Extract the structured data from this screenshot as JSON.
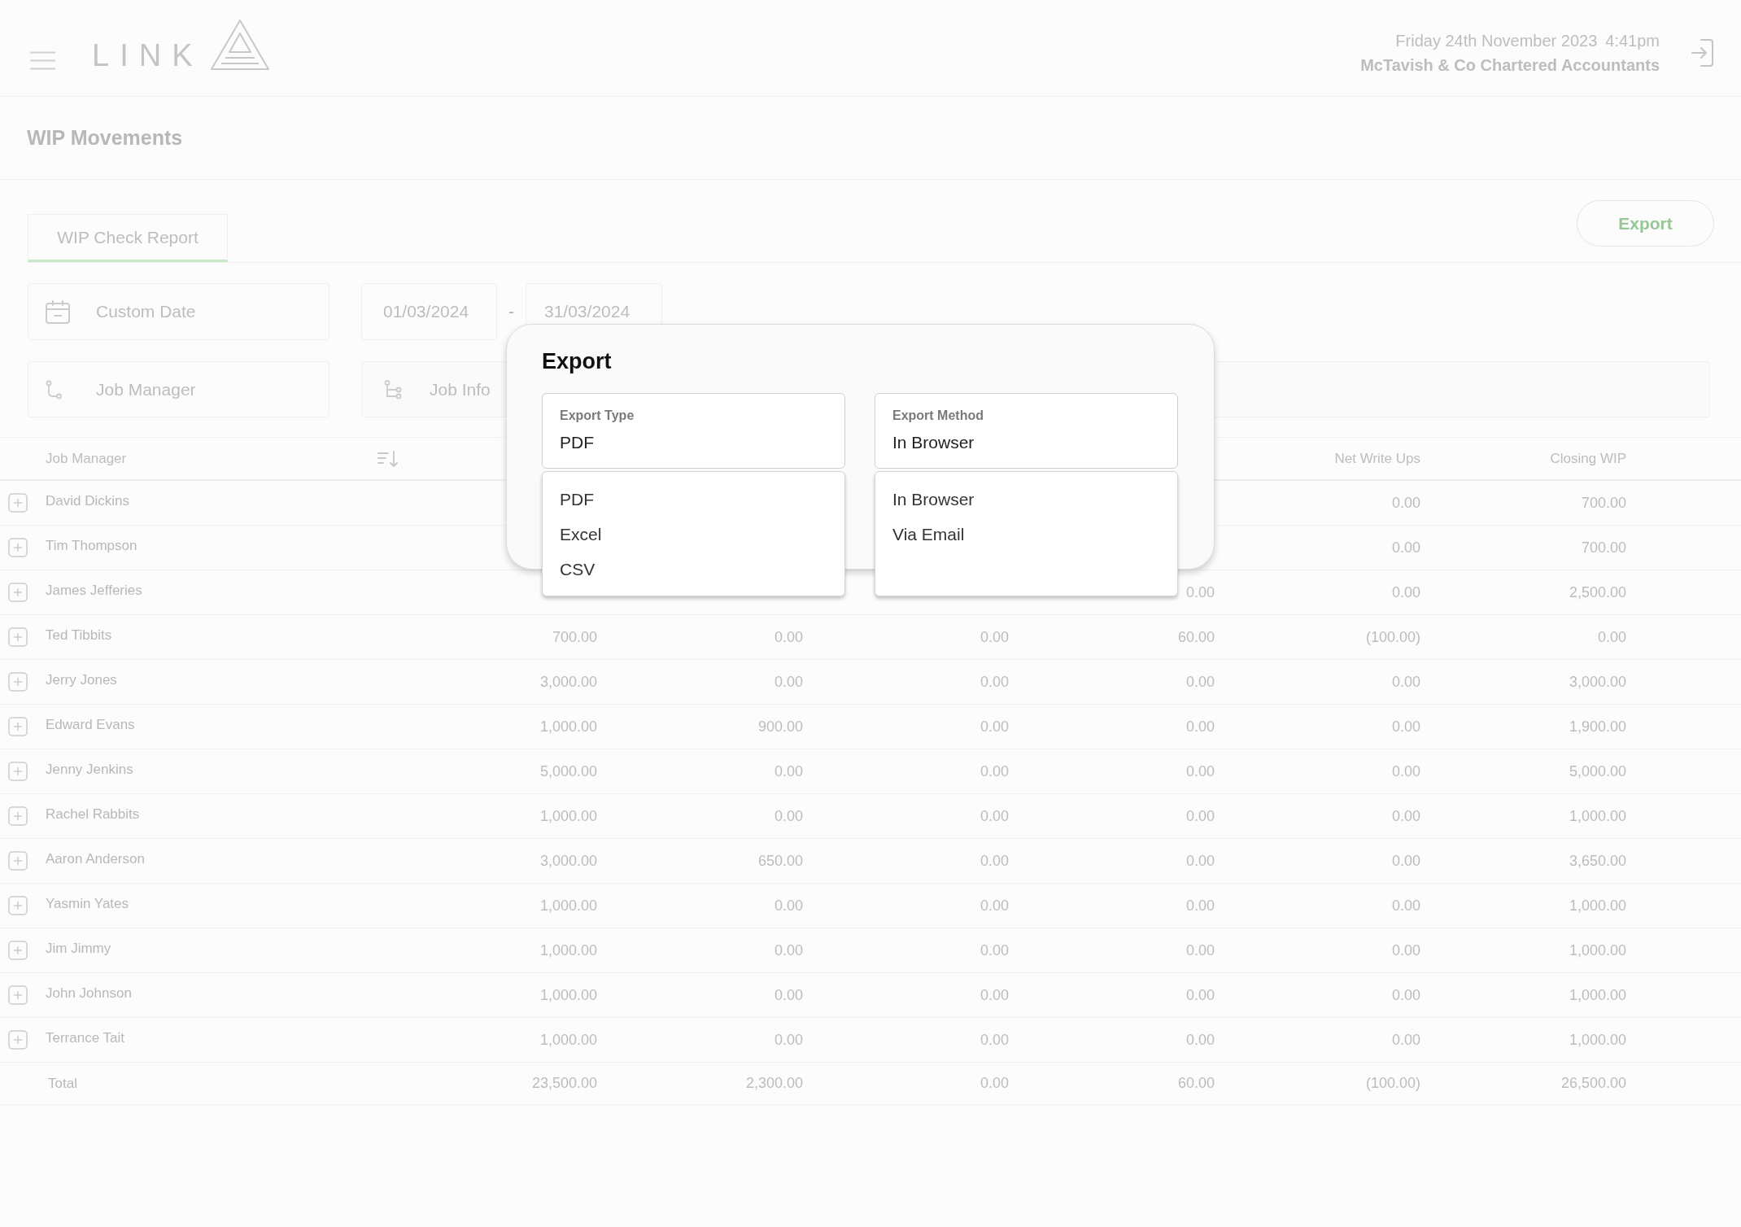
{
  "header": {
    "logo_text": "LINK",
    "date": "Friday 24th November 2023",
    "time": "4:41pm",
    "company": "McTavish & Co Chartered Accountants"
  },
  "page_title": "WIP Movements",
  "tabs": [
    {
      "label": "WIP Check Report",
      "selected": true
    }
  ],
  "export_button": {
    "label": "Export"
  },
  "filters": {
    "date_range": {
      "label": "Custom Date"
    },
    "date_from": {
      "value": "01/03/2024"
    },
    "date_separator": "-",
    "date_to": {
      "value": "31/03/2024"
    },
    "job_manager": {
      "label": "Job Manager"
    },
    "job_info": {
      "label": "Job Info"
    }
  },
  "table": {
    "header": {
      "job_manager": "Job Manager",
      "net_write_ups": "Net Write Ups",
      "closing_wip": "Closing WIP"
    },
    "rows": [
      {
        "job_manager": "David Dickins",
        "expanded": false,
        "net_write_ups": "0.00",
        "closing_wip": "700.00"
      },
      {
        "job_manager": "Tim Thompson",
        "expanded": false,
        "net_write_ups": "0.00",
        "closing_wip": "700.00"
      },
      {
        "job_manager": "James Jefferies",
        "expanded": false,
        "column_5": "0.00",
        "net_write_ups": "0.00",
        "closing_wip": "2,500.00"
      },
      {
        "job_manager": "Ted Tibbits",
        "expanded": false,
        "column_2": "700.00",
        "column_3": "0.00",
        "column_4": "0.00",
        "column_5": "60.00",
        "net_write_ups": "(100.00)",
        "closing_wip": "0.00"
      },
      {
        "job_manager": "Jerry Jones",
        "expanded": false,
        "column_2": "3,000.00",
        "column_3": "0.00",
        "column_4": "0.00",
        "column_5": "0.00",
        "net_write_ups": "0.00",
        "closing_wip": "3,000.00"
      },
      {
        "job_manager": "Edward Evans",
        "expanded": false,
        "column_2": "1,000.00",
        "column_3": "900.00",
        "column_4": "0.00",
        "column_5": "0.00",
        "net_write_ups": "0.00",
        "closing_wip": "1,900.00"
      },
      {
        "job_manager": "Jenny Jenkins",
        "expanded": false,
        "column_2": "5,000.00",
        "column_3": "0.00",
        "column_4": "0.00",
        "column_5": "0.00",
        "net_write_ups": "0.00",
        "closing_wip": "5,000.00"
      },
      {
        "job_manager": "Rachel Rabbits",
        "expanded": false,
        "column_2": "1,000.00",
        "column_3": "0.00",
        "column_4": "0.00",
        "column_5": "0.00",
        "net_write_ups": "0.00",
        "closing_wip": "1,000.00"
      },
      {
        "job_manager": "Aaron Anderson",
        "expanded": false,
        "column_2": "3,000.00",
        "column_3": "650.00",
        "column_4": "0.00",
        "column_5": "0.00",
        "net_write_ups": "0.00",
        "closing_wip": "3,650.00"
      },
      {
        "job_manager": "Yasmin Yates",
        "expanded": false,
        "column_2": "1,000.00",
        "column_3": "0.00",
        "column_4": "0.00",
        "column_5": "0.00",
        "net_write_ups": "0.00",
        "closing_wip": "1,000.00"
      },
      {
        "job_manager": "Jim Jimmy",
        "expanded": false,
        "column_2": "1,000.00",
        "column_3": "0.00",
        "column_4": "0.00",
        "column_5": "0.00",
        "net_write_ups": "0.00",
        "closing_wip": "1,000.00"
      },
      {
        "job_manager": "John Johnson",
        "expanded": false,
        "column_2": "1,000.00",
        "column_3": "0.00",
        "column_4": "0.00",
        "column_5": "0.00",
        "net_write_ups": "0.00",
        "closing_wip": "1,000.00"
      },
      {
        "job_manager": "Terrance Tait",
        "expanded": false,
        "column_2": "1,000.00",
        "column_3": "0.00",
        "column_4": "0.00",
        "column_5": "0.00",
        "net_write_ups": "0.00",
        "closing_wip": "1,000.00"
      }
    ],
    "total": {
      "label": "Total",
      "column_2": "23,500.00",
      "column_3": "2,300.00",
      "column_4": "0.00",
      "column_5": "60.00",
      "net_write_ups": "(100.00)",
      "closing_wip": "26,500.00"
    }
  },
  "export_dialog": {
    "title": "Export",
    "fields": [
      {
        "label": "Export Type",
        "value": "PDF",
        "expanded": true,
        "options": [
          "PDF",
          "Excel",
          "CSV"
        ]
      },
      {
        "label": "Export Method",
        "value": "In Browser",
        "expanded": true,
        "options": [
          "In Browser",
          "Via Email"
        ]
      }
    ]
  }
}
